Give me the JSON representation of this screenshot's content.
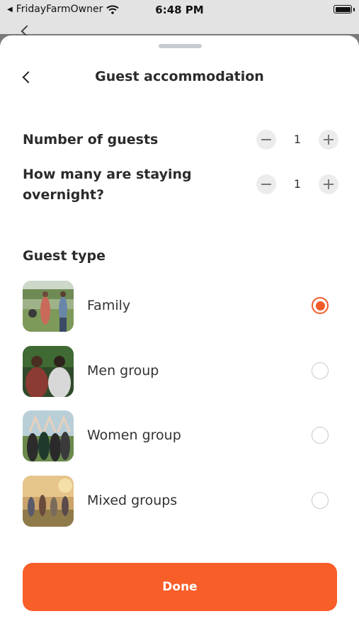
{
  "status_bar": {
    "carrier": "FridayFarmOwner",
    "time": "6:48 PM"
  },
  "header": {
    "title": "Guest accommodation"
  },
  "counters": [
    {
      "label": "Number of guests",
      "value": "1"
    },
    {
      "label_line1": "How many are staying",
      "label_line2": "overnight?",
      "value": "1"
    }
  ],
  "guest_type": {
    "title": "Guest type",
    "options": [
      {
        "label": "Family",
        "selected": true
      },
      {
        "label": "Men group",
        "selected": false
      },
      {
        "label": "Women group",
        "selected": false
      },
      {
        "label": "Mixed groups",
        "selected": false
      }
    ]
  },
  "done_button": {
    "label": "Done"
  },
  "colors": {
    "accent": "#f85e28",
    "radio_selected": "#f15a29"
  },
  "icons": [
    "back-chevron-icon",
    "minus-icon",
    "plus-icon",
    "wifi-icon",
    "battery-icon"
  ]
}
